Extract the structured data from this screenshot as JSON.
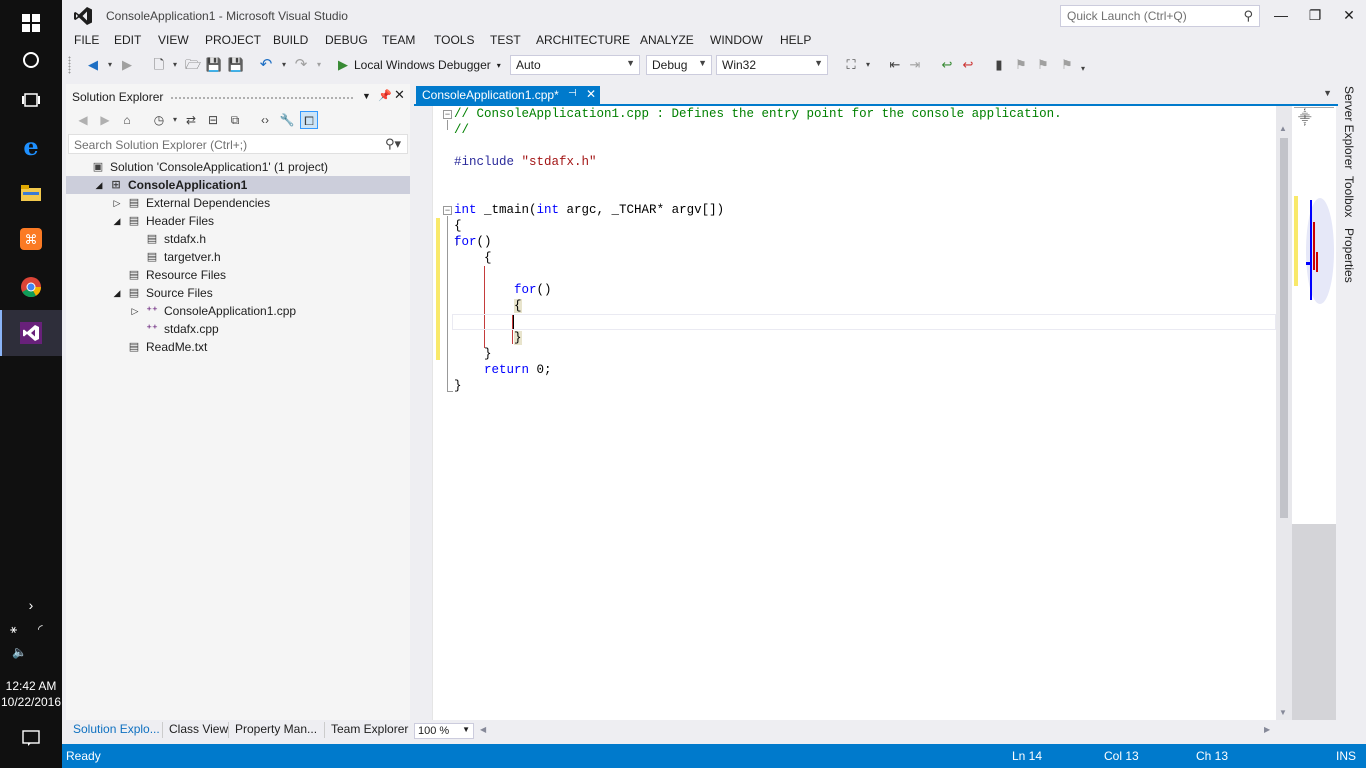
{
  "window": {
    "title": "ConsoleApplication1 - Microsoft Visual Studio",
    "quick_launch_placeholder": "Quick Launch (Ctrl+Q)"
  },
  "menu": [
    "FILE",
    "EDIT",
    "VIEW",
    "PROJECT",
    "BUILD",
    "DEBUG",
    "TEAM",
    "TOOLS",
    "TEST",
    "ARCHITECTURE",
    "ANALYZE",
    "WINDOW",
    "HELP"
  ],
  "toolbar": {
    "debugger_label": "Local Windows Debugger",
    "config_auto": "Auto",
    "config_debug": "Debug",
    "platform": "Win32"
  },
  "solution_explorer": {
    "title": "Solution Explorer",
    "search_placeholder": "Search Solution Explorer (Ctrl+;)",
    "tree": [
      {
        "label": "Solution 'ConsoleApplication1' (1 project)",
        "icon": "solution-icon",
        "level": 0,
        "expander": ""
      },
      {
        "label": "ConsoleApplication1",
        "icon": "project-icon",
        "level": 1,
        "expander": "expanded",
        "selected": true
      },
      {
        "label": "External Dependencies",
        "icon": "folder-icon",
        "level": 2,
        "expander": "collapsed"
      },
      {
        "label": "Header Files",
        "icon": "filter-icon",
        "level": 2,
        "expander": "expanded"
      },
      {
        "label": "stdafx.h",
        "icon": "header-file-icon",
        "level": 3,
        "expander": ""
      },
      {
        "label": "targetver.h",
        "icon": "header-file-icon",
        "level": 3,
        "expander": ""
      },
      {
        "label": "Resource Files",
        "icon": "filter-icon",
        "level": 2,
        "expander": ""
      },
      {
        "label": "Source Files",
        "icon": "filter-icon",
        "level": 2,
        "expander": "expanded"
      },
      {
        "label": "ConsoleApplication1.cpp",
        "icon": "cpp-file-icon",
        "level": 3,
        "expander": "collapsed"
      },
      {
        "label": "stdafx.cpp",
        "icon": "cpp-file-icon",
        "level": 3,
        "expander": ""
      },
      {
        "label": "ReadMe.txt",
        "icon": "text-file-icon",
        "level": 2,
        "expander": ""
      }
    ]
  },
  "bottom_tabs": [
    "Solution Explo...",
    "Class View",
    "Property Man...",
    "Team Explorer"
  ],
  "editor": {
    "tab_label": "ConsoleApplication1.cpp*",
    "zoom": "100 %",
    "code": {
      "l1": "// ConsoleApplication1.cpp : Defines the entry point for the console application.",
      "l2": "//",
      "l3_dir": "#include",
      "l3_str": "\"stdafx.h\"",
      "l4_kw1": "int",
      "l4_a": " _tmain(",
      "l4_kw2": "int",
      "l4_b": " argc, _TCHAR* argv[])",
      "l5": "{",
      "l6_kw": "for",
      "l6_rest": "()",
      "l7": "{",
      "l8_kw": "for",
      "l8_rest": "()",
      "l9": "{",
      "l10": "}",
      "l11": "}",
      "l12_kw": "return",
      "l12_rest": " 0;",
      "l13": "}"
    }
  },
  "right_tabs": [
    "Server Explorer",
    "Toolbox",
    "Properties"
  ],
  "status": {
    "state": "Ready",
    "ln": "Ln 14",
    "col": "Col 13",
    "ch": "Ch 13",
    "mode": "INS"
  },
  "taskbar": {
    "time": "12:42 AM",
    "date": "10/22/2016"
  }
}
